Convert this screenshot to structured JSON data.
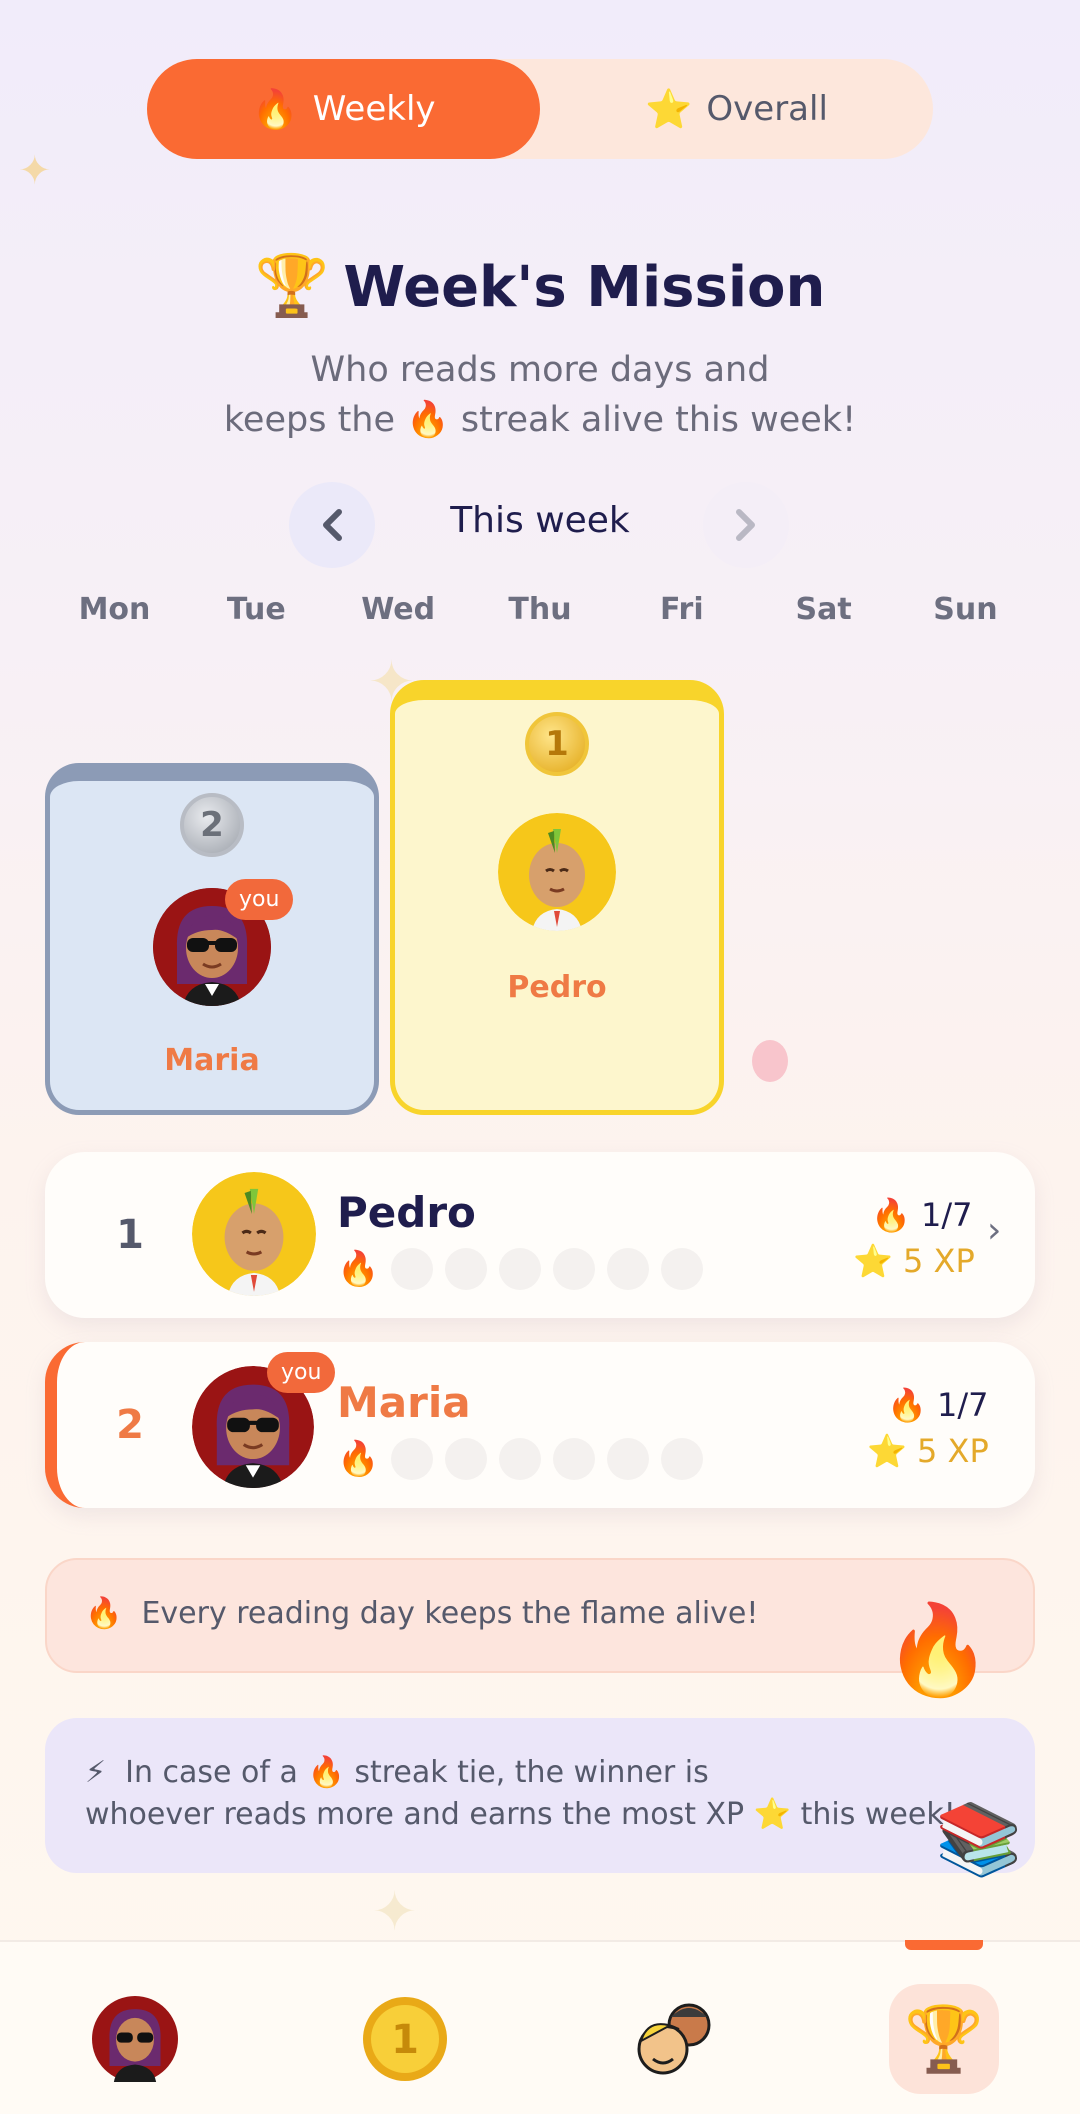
{
  "tabs": {
    "weekly": {
      "label": "Weekly",
      "icon": "🔥"
    },
    "overall": {
      "label": "Overall",
      "icon": "⭐"
    }
  },
  "mission": {
    "icon": "🏆",
    "title": "Week's Mission",
    "subtitle_line1": "Who reads more days and",
    "subtitle_line2_pre": "keeps the",
    "subtitle_line2_icon": "🔥",
    "subtitle_line2_post": "streak alive this week!"
  },
  "week_nav": {
    "label": "This week",
    "prev_icon": "chevron-left-icon",
    "next_icon": "chevron-right-icon",
    "days": [
      "Mon",
      "Tue",
      "Wed",
      "Thu",
      "Fri",
      "Sat",
      "Sun"
    ]
  },
  "podium": {
    "first": {
      "name": "Pedro",
      "medal": "1"
    },
    "second": {
      "name": "Maria",
      "medal": "2",
      "badge": "you"
    }
  },
  "leaderboard": [
    {
      "rank": "1",
      "name": "Pedro",
      "streak": "1/7",
      "xp": "5 XP",
      "days_read": 1,
      "days_total": 7
    },
    {
      "rank": "2",
      "name": "Maria",
      "badge": "you",
      "streak": "1/7",
      "xp": "5 XP",
      "days_read": 1,
      "days_total": 7
    }
  ],
  "icons": {
    "fire": "🔥",
    "star": "⭐",
    "bolt": "⚡",
    "books": "📚"
  },
  "info": {
    "flame_card": "Every reading day keeps the flame alive!",
    "tie_line1_pre": "In case of a",
    "tie_line1_post": "streak tie, the winner is",
    "tie_line2_pre": "whoever reads more and earns the most XP",
    "tie_line2_post": "this week!"
  },
  "bottom_nav": [
    "profile",
    "coins",
    "friends",
    "leaderboard"
  ],
  "colors": {
    "accent": "#fa6a33",
    "gold": "#f8d42b",
    "silver": "#8c9bb6",
    "text_dark": "#1f1d4d"
  }
}
